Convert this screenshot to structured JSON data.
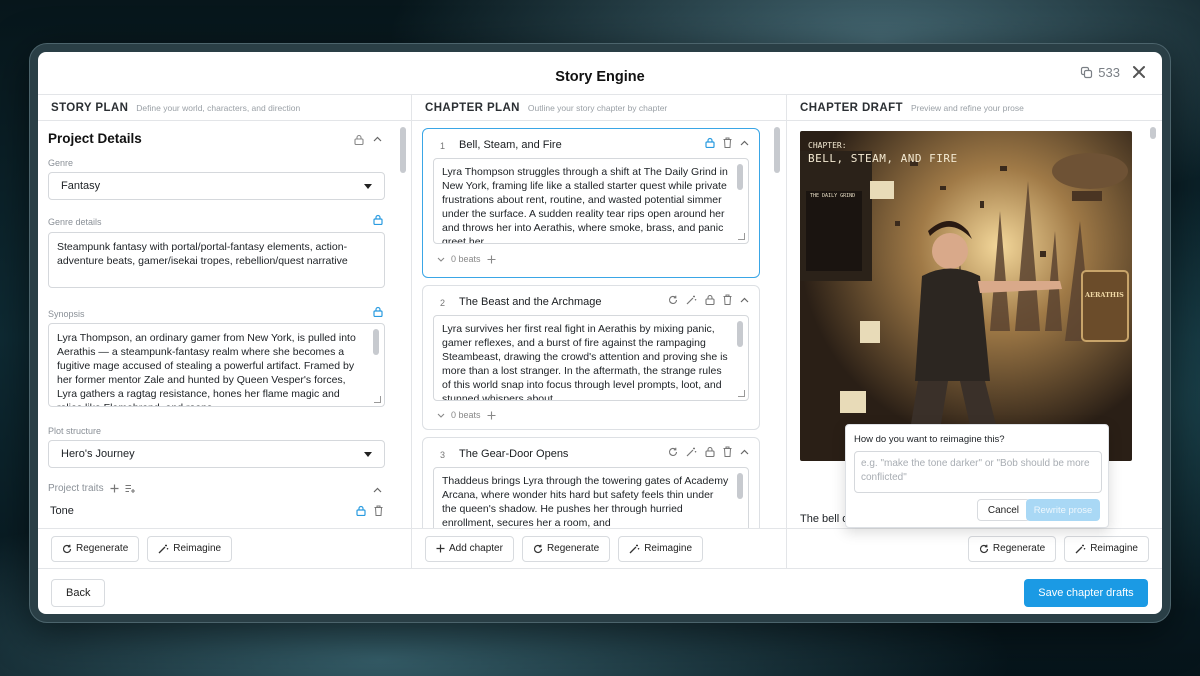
{
  "app": {
    "title": "Story Engine",
    "credits": "533"
  },
  "columns": {
    "story_plan": {
      "title": "STORY PLAN",
      "subtitle": "Define your world, characters, and direction"
    },
    "chapter_plan": {
      "title": "CHAPTER PLAN",
      "subtitle": "Outline your story chapter by chapter"
    },
    "chapter_draft": {
      "title": "CHAPTER DRAFT",
      "subtitle": "Preview and refine your prose"
    }
  },
  "project": {
    "section_title": "Project Details",
    "genre_label": "Genre",
    "genre_value": "Fantasy",
    "genre_details_label": "Genre details",
    "genre_details_value": "Steampunk fantasy with portal/portal-fantasy elements, action-adventure beats, gamer/isekai tropes, rebellion/quest narrative",
    "synopsis_label": "Synopsis",
    "synopsis_value": "Lyra Thompson, an ordinary gamer from New York, is pulled into Aerathis — a steampunk-fantasy realm where she becomes a fugitive mage accused of stealing a powerful artifact. Framed by her former mentor Zale and hunted by Queen Vesper's forces, Lyra gathers a ragtag resistance, hones her flame magic and relies like Flamebrand, and reaps",
    "plot_structure_label": "Plot structure",
    "plot_structure_value": "Hero's Journey",
    "traits_label": "Project traits",
    "trait_tone": "Tone"
  },
  "chapters": [
    {
      "num": "1",
      "title": "Bell, Steam, and Fire",
      "text": "Lyra Thompson struggles through a shift at The Daily Grind in New York, framing life like a stalled starter quest while private frustrations about rent, routine, and wasted potential simmer under the surface. A sudden reality tear rips open around her and throws her into Aerathis, where smoke, brass, and panic greet her.",
      "beats": "0 beats"
    },
    {
      "num": "2",
      "title": "The Beast and the Archmage",
      "text": "Lyra survives her first real fight in Aerathis by mixing panic, gamer reflexes, and a burst of fire against the rampaging Steambeast, drawing the crowd's attention and proving she is more than a lost stranger. In the aftermath, the strange rules of this world snap into focus through level prompts, loot, and stunned whispers about",
      "beats": "0 beats"
    },
    {
      "num": "3",
      "title": "The Gear-Door Opens",
      "text": "Thaddeus brings Lyra through the towering gates of Academy Arcana, where wonder hits hard but safety feels thin under the queen's shadow. He pushes her through hurried enrollment, secures her a room, and",
      "beats": "0 beats"
    }
  ],
  "draft": {
    "image_caption_lines": [
      "CHAPTER:",
      "BELL, STEAM, AND FIRE"
    ],
    "board_title": "THE DAILY GRIND",
    "sign_text": "AERATHIS",
    "text_start": "The bell over the",
    "style": "Default Style"
  },
  "reimagine_popover": {
    "question": "How do you want to reimagine this?",
    "placeholder": "e.g. \"make the tone darker\" or \"Bob should be more conflicted\"",
    "cancel": "Cancel",
    "rewrite": "Rewrite prose"
  },
  "buttons": {
    "regenerate": "Regenerate",
    "reimagine": "Reimagine",
    "add_chapter": "Add chapter",
    "back": "Back",
    "save": "Save chapter drafts"
  },
  "colors": {
    "accent": "#1b9ae4",
    "lock": "#2a9be0"
  }
}
